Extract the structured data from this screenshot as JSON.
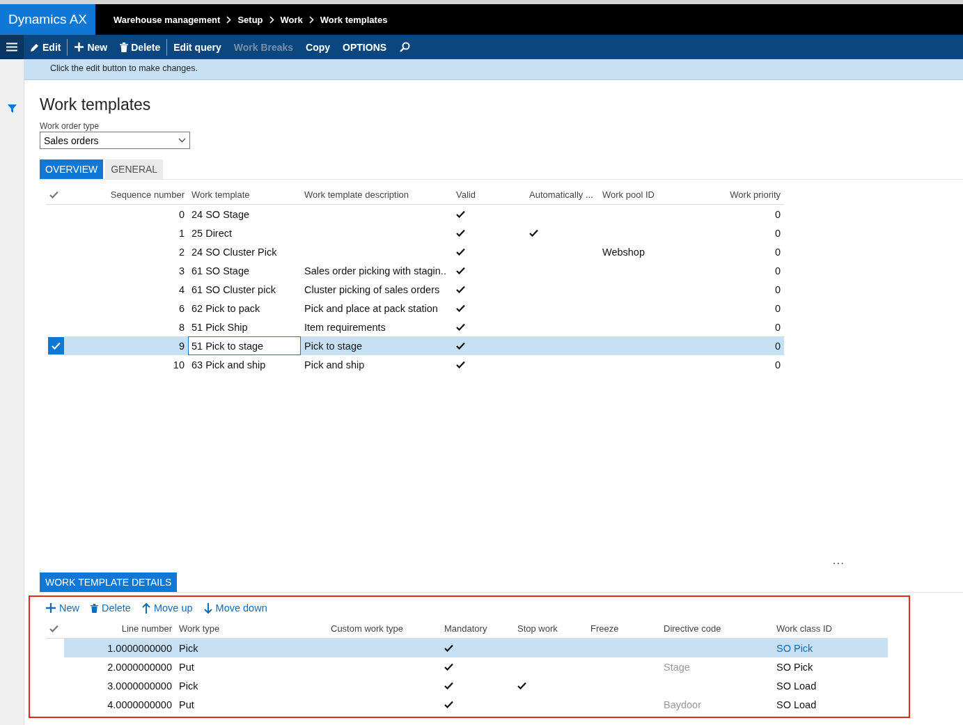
{
  "header": {
    "app_title": "Dynamics AX",
    "breadcrumb": [
      "Warehouse management",
      "Setup",
      "Work",
      "Work templates"
    ]
  },
  "toolbar": [
    {
      "label": "Edit",
      "kind": "edit",
      "disabled": false
    },
    {
      "label": "New",
      "kind": "new",
      "disabled": false
    },
    {
      "label": "Delete",
      "kind": "delete",
      "disabled": false
    },
    {
      "label": "Edit query",
      "kind": "plain",
      "disabled": false
    },
    {
      "label": "Work Breaks",
      "kind": "plain",
      "disabled": true
    },
    {
      "label": "Copy",
      "kind": "plain",
      "disabled": false
    },
    {
      "label": "OPTIONS",
      "kind": "plain",
      "disabled": false
    }
  ],
  "message": "Click the edit button to make changes.",
  "page_title": "Work templates",
  "filter": {
    "label": "Work order type",
    "value": "Sales orders"
  },
  "tabs": [
    {
      "label": "OVERVIEW",
      "selected": true
    },
    {
      "label": "GENERAL",
      "selected": false
    }
  ],
  "grid": {
    "columns": [
      "Sequence number",
      "Work template",
      "Work template description",
      "Valid",
      "Automatically ...",
      "Work pool ID",
      "Work priority"
    ],
    "rows": [
      {
        "seq": "0",
        "template": "24 SO Stage",
        "valid": true,
        "auto": false,
        "priority": "0",
        "selected": false,
        "focused": false
      },
      {
        "seq": "1",
        "template": "25 Direct",
        "valid": true,
        "auto": true,
        "priority": "0",
        "selected": false,
        "focused": false
      },
      {
        "seq": "2",
        "template": "24 SO Cluster Pick",
        "valid": true,
        "auto": false,
        "pool": "Webshop",
        "priority": "0",
        "selected": false,
        "focused": false
      },
      {
        "seq": "3",
        "template": "61 SO Stage",
        "description": "Sales order picking with stagin..",
        "valid": true,
        "auto": false,
        "priority": "0",
        "selected": false,
        "focused": false
      },
      {
        "seq": "4",
        "template": "61 SO Cluster pick",
        "description": "Cluster picking of sales orders",
        "valid": true,
        "auto": false,
        "priority": "0",
        "selected": false,
        "focused": false
      },
      {
        "seq": "6",
        "template": "62 Pick to pack",
        "description": "Pick and place at pack station",
        "valid": true,
        "auto": false,
        "priority": "0",
        "selected": false,
        "focused": false
      },
      {
        "seq": "8",
        "template": "51 Pick Ship",
        "description": "Item requirements",
        "valid": true,
        "auto": false,
        "priority": "0",
        "selected": false,
        "focused": false
      },
      {
        "seq": "9",
        "template": "51 Pick to stage",
        "description": "Pick to stage",
        "valid": true,
        "auto": false,
        "priority": "0",
        "selected": true,
        "focused": true
      },
      {
        "seq": "10",
        "template": "63 Pick and ship",
        "description": "Pick and ship",
        "valid": true,
        "auto": false,
        "priority": "0",
        "selected": false,
        "focused": false
      }
    ]
  },
  "more": "...",
  "details": {
    "title": "WORK TEMPLATE DETAILS",
    "actions": [
      {
        "label": "New",
        "kind": "new"
      },
      {
        "label": "Delete",
        "kind": "delete"
      },
      {
        "label": "Move up",
        "kind": "up"
      },
      {
        "label": "Move down",
        "kind": "down"
      }
    ],
    "columns": [
      "Line number",
      "Work type",
      "Custom work type",
      "Mandatory",
      "Stop work",
      "Freeze",
      "Directive code",
      "Work class ID"
    ],
    "rows": [
      {
        "line": "1.0000000000",
        "work_type": "Pick",
        "mandatory": true,
        "stop_work": false,
        "work_class": "SO Pick",
        "selected": true
      },
      {
        "line": "2.0000000000",
        "work_type": "Put",
        "mandatory": true,
        "stop_work": false,
        "directive": "Stage",
        "work_class": "SO Pick",
        "selected": false
      },
      {
        "line": "3.0000000000",
        "work_type": "Pick",
        "mandatory": true,
        "stop_work": true,
        "work_class": "SO Load",
        "selected": false
      },
      {
        "line": "4.0000000000",
        "work_type": "Put",
        "mandatory": true,
        "stop_work": false,
        "directive": "Baydoor",
        "work_class": "SO Load",
        "selected": false
      }
    ]
  }
}
